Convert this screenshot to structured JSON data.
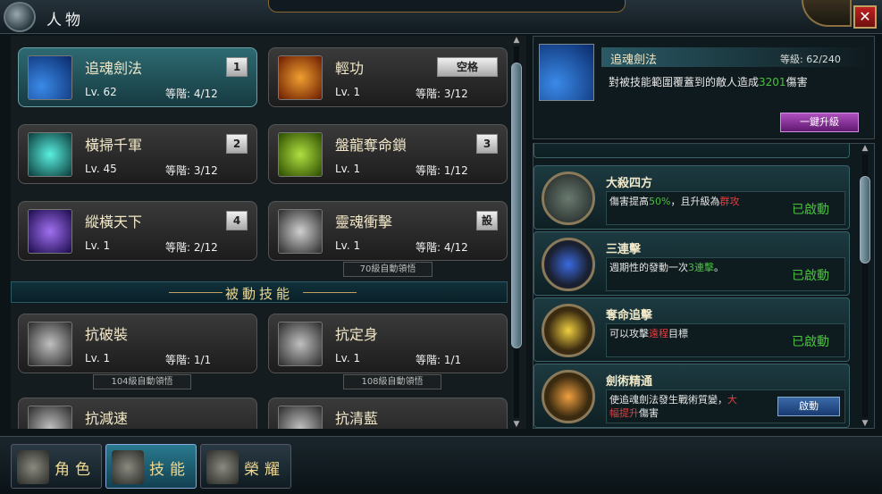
{
  "window": {
    "title": "人物",
    "close_label": "✕"
  },
  "active_skills": [
    {
      "name": "追魂劍法",
      "lv": "Lv. 62",
      "grade": "等階:  4/12",
      "key": "1",
      "selected": true
    },
    {
      "name": "輕功",
      "lv": "Lv. 1",
      "grade": "等階:  3/12",
      "key": "空格"
    },
    {
      "name": "橫掃千軍",
      "lv": "Lv. 45",
      "grade": "等階:  3/12",
      "key": "2"
    },
    {
      "name": "盤龍奪命鎖",
      "lv": "Lv. 1",
      "grade": "等階:  1/12",
      "key": "3"
    },
    {
      "name": "縱橫天下",
      "lv": "Lv. 1",
      "grade": "等階:  2/12",
      "key": "4"
    },
    {
      "name": "靈魂衝擊",
      "lv": "Lv. 1",
      "grade": "等階:  4/12",
      "key": "設"
    }
  ],
  "active_auto_note": "70級自動領悟",
  "passive_header": "被動技能",
  "passive_skills": [
    {
      "name": "抗破裝",
      "lv": "Lv. 1",
      "grade": "等階:  1/1",
      "note": "104級自動領悟"
    },
    {
      "name": "抗定身",
      "lv": "Lv. 1",
      "grade": "等階:  1/1",
      "note": "108級自動領悟"
    },
    {
      "name": "抗減速"
    },
    {
      "name": "抗清藍"
    }
  ],
  "detail": {
    "name": "追魂劍法",
    "level_label": "等級: 62/240",
    "desc_prefix": "對被技能範圍覆蓋到的敵人造成",
    "desc_value": "3201",
    "desc_suffix": "傷害",
    "upgrade_button": "一鍵升級"
  },
  "talents": [
    {
      "name": "大殺四方",
      "desc_parts": [
        "傷害提高",
        "50%",
        "，且升級為",
        "群攻"
      ],
      "status": "已啟動"
    },
    {
      "name": "三連擊",
      "desc_parts": [
        "週期性的發動一次",
        "3連擊",
        "。"
      ],
      "status": "已啟動"
    },
    {
      "name": "奪命追擊",
      "desc_parts": [
        "可以攻擊",
        "遠程",
        "目標"
      ],
      "status": "已啟動"
    },
    {
      "name": "劍術精通",
      "desc_parts": [
        "使追魂劍法發生戰術質變，",
        "大幅提升",
        "傷害"
      ],
      "button": "啟動"
    }
  ],
  "bottom_tabs": [
    {
      "label": "角色",
      "active": false
    },
    {
      "label": "技能",
      "active": true
    },
    {
      "label": "榮耀",
      "active": false
    }
  ]
}
